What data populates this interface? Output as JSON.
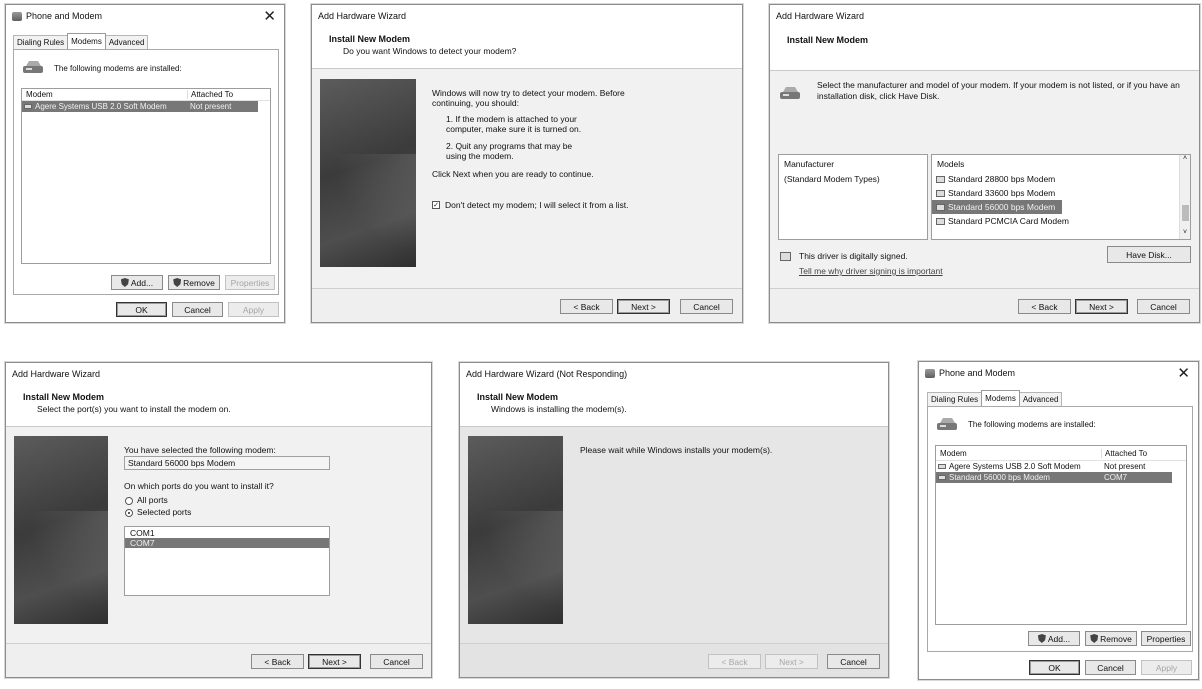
{
  "w1": {
    "title": "Phone and Modem",
    "tabs": [
      "Dialing Rules",
      "Modems",
      "Advanced"
    ],
    "intro": "The following modems are installed:",
    "col_modem": "Modem",
    "col_attached": "Attached To",
    "rows": [
      {
        "modem": "Agere Systems USB 2.0 Soft Modem",
        "attached": "Not present"
      }
    ],
    "add": "Add...",
    "remove": "Remove",
    "properties": "Properties",
    "ok": "OK",
    "cancel": "Cancel",
    "apply": "Apply"
  },
  "w2": {
    "title": "Add Hardware Wizard",
    "h1": "Install New Modem",
    "h2": "Do you want Windows to detect your modem?",
    "p1": "Windows will now try to detect your modem.  Before continuing, you should:",
    "s1": "1.  If the modem is attached to your computer, make sure it is turned on.",
    "s2": "2.  Quit any programs that may be using the modem.",
    "p2": "Click Next when you are ready to continue.",
    "checkbox": "Don't detect my modem; I will select it from a list.",
    "back": "< Back",
    "next": "Next >",
    "cancel": "Cancel"
  },
  "w3": {
    "title": "Add Hardware Wizard",
    "h1": "Install New Modem",
    "desc": "Select the manufacturer and model of your modem. If your modem is not listed, or if you have an installation disk, click Have Disk.",
    "manufacturer_label": "Manufacturer",
    "manufacturers": [
      "(Standard Modem Types)"
    ],
    "models_label": "Models",
    "models": [
      "Standard 28800 bps Modem",
      "Standard 33600 bps Modem",
      "Standard 56000 bps Modem",
      "Standard PCMCIA Card Modem"
    ],
    "signed": "This driver is digitally signed.",
    "signing_link": "Tell me why driver signing is important",
    "have_disk": "Have Disk...",
    "back": "< Back",
    "next": "Next >",
    "cancel": "Cancel"
  },
  "w4": {
    "title": "Add Hardware Wizard",
    "h1": "Install New Modem",
    "h2": "Select the port(s) you want to install the modem on.",
    "selected_label": "You have selected the following modem:",
    "selected_value": "Standard 56000 bps Modem",
    "ports_question": "On which ports do you want to install it?",
    "opt_all": "All ports",
    "opt_selected": "Selected ports",
    "ports": [
      "COM1",
      "COM7"
    ],
    "back": "< Back",
    "next": "Next >",
    "cancel": "Cancel"
  },
  "w5": {
    "title": "Add Hardware Wizard (Not Responding)",
    "h1": "Install New Modem",
    "h2": "Windows is installing the modem(s).",
    "msg": "Please wait while Windows installs your modem(s).",
    "back": "< Back",
    "next": "Next >",
    "cancel": "Cancel"
  },
  "w6": {
    "title": "Phone and Modem",
    "tabs": [
      "Dialing Rules",
      "Modems",
      "Advanced"
    ],
    "intro": "The following modems are installed:",
    "col_modem": "Modem",
    "col_attached": "Attached To",
    "rows": [
      {
        "modem": "Agere Systems USB 2.0 Soft Modem",
        "attached": "Not present"
      },
      {
        "modem": "Standard 56000 bps Modem",
        "attached": "COM7"
      }
    ],
    "add": "Add...",
    "remove": "Remove",
    "properties": "Properties",
    "ok": "OK",
    "cancel": "Cancel",
    "apply": "Apply"
  }
}
